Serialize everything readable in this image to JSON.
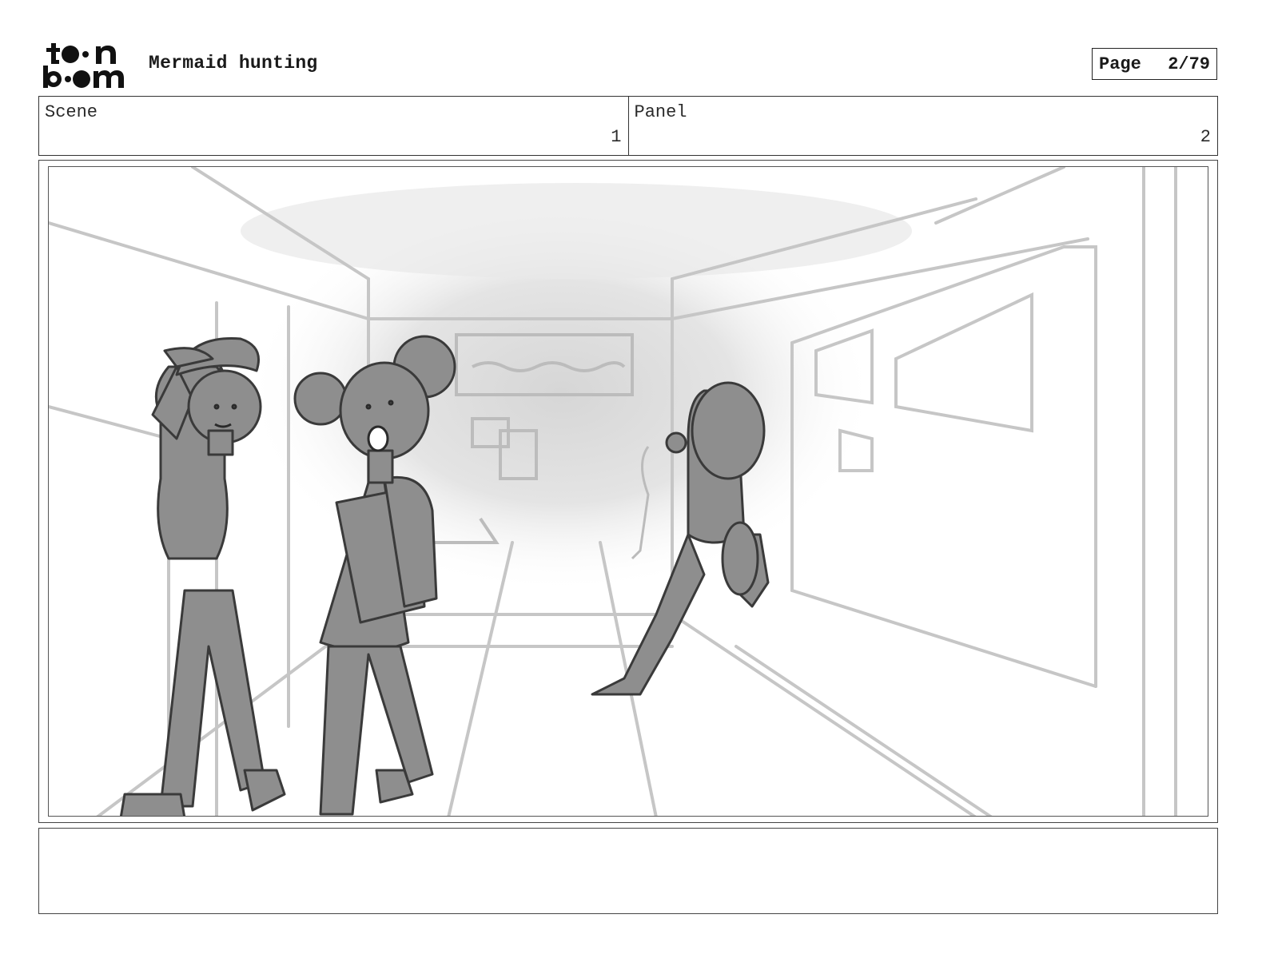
{
  "header": {
    "logo": {
      "line1": "toon",
      "line2": "boom"
    },
    "title": "Mermaid hunting",
    "page_label": "Page",
    "page_number": "2/79"
  },
  "info": {
    "scene_label": "Scene",
    "scene_value": "1",
    "panel_label": "Panel",
    "panel_value": "2"
  },
  "notes": {
    "text": ""
  }
}
